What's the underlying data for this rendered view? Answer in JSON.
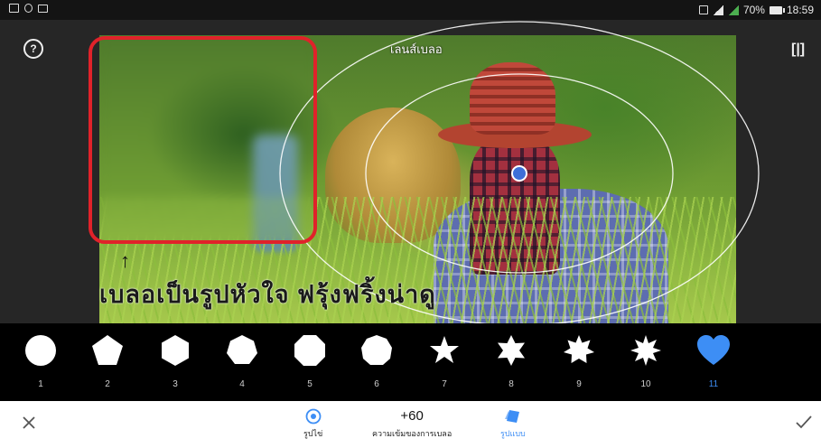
{
  "status_bar": {
    "battery": "70%",
    "time": "18:59"
  },
  "editor": {
    "lens_label": "เลนส์เบลอ",
    "annotation": {
      "caption": "เบลอเป็นรูปหัวใจ ฟรุ้งฟริ้งน่าดู"
    }
  },
  "shapes": [
    {
      "number": "1",
      "icon": "circle-icon"
    },
    {
      "number": "2",
      "icon": "pentagon-icon"
    },
    {
      "number": "3",
      "icon": "hexagon-icon"
    },
    {
      "number": "4",
      "icon": "heptagon-icon"
    },
    {
      "number": "5",
      "icon": "octagon-icon"
    },
    {
      "number": "6",
      "icon": "nonagon-icon"
    },
    {
      "number": "7",
      "icon": "five-point-star-icon"
    },
    {
      "number": "8",
      "icon": "six-point-star-icon"
    },
    {
      "number": "9",
      "icon": "seven-point-star-icon"
    },
    {
      "number": "10",
      "icon": "eight-point-star-icon"
    },
    {
      "number": "11",
      "icon": "heart-icon",
      "selected": true
    }
  ],
  "toolbar": {
    "mode_label": "รูปไข่",
    "strength_value": "+60",
    "strength_label": "ความเข้มของการเบลอ",
    "shape_label": "รูปแบบ"
  },
  "colors": {
    "accent": "#3d8ef5",
    "highlight_box": "#e0222a"
  }
}
